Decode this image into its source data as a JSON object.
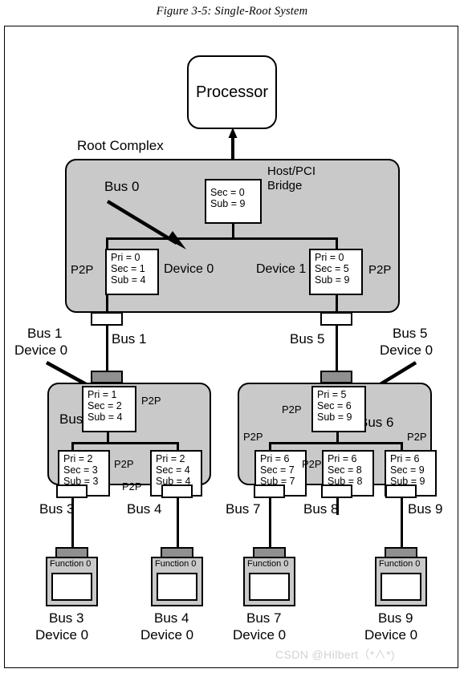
{
  "caption": "Figure 3-5: Single-Root System",
  "watermark": "CSDN @Hilbert（*∧*)",
  "processor": {
    "label": "Processor"
  },
  "root_complex": {
    "title": "Root Complex",
    "bus_label": "Bus 0",
    "bridge_title_line1": "Host/PCI",
    "bridge_title_line2": "Bridge",
    "bridge_regs": {
      "sec": "Sec = 0",
      "sub": "Sub = 9"
    },
    "device0_label": "Device 0",
    "device1_label": "Device 1",
    "p2p_left_label": "P2P",
    "p2p_right_label": "P2P",
    "port0_regs": {
      "pri": "Pri = 0",
      "sec": "Sec = 1",
      "sub": "Sub = 4"
    },
    "port1_regs": {
      "pri": "Pri = 0",
      "sec": "Sec = 5",
      "sub": "Sub = 9"
    }
  },
  "links": {
    "bus1_left_callout_line1": "Bus 1",
    "bus1_left_callout_line2": "Device 0",
    "bus1_label": "Bus 1",
    "bus5_label": "Bus 5",
    "bus5_right_callout_line1": "Bus 5",
    "bus5_right_callout_line2": "Device 0"
  },
  "switch_left": {
    "bus_label": "Bus 2",
    "upstream": {
      "p2p_label": "P2P",
      "regs": {
        "pri": "Pri = 1",
        "sec": "Sec = 2",
        "sub": "Sub = 4"
      }
    },
    "downstream": [
      {
        "p2p_label": "P2P",
        "regs": {
          "pri": "Pri = 2",
          "sec": "Sec = 3",
          "sub": "Sub = 3"
        },
        "bus_label": "Bus 3"
      },
      {
        "p2p_label": "P2P",
        "regs": {
          "pri": "Pri = 2",
          "sec": "Sec = 4",
          "sub": "Sub = 4"
        },
        "bus_label": "Bus 4"
      }
    ]
  },
  "switch_right": {
    "bus_label": "Bus 6",
    "upstream": {
      "p2p_label": "P2P",
      "regs": {
        "pri": "Pri = 5",
        "sec": "Sec = 6",
        "sub": "Sub = 9"
      }
    },
    "downstream": [
      {
        "p2p_label": "P2P",
        "regs": {
          "pri": "Pri = 6",
          "sec": "Sec = 7",
          "sub": "Sub = 7"
        },
        "bus_label": "Bus 7"
      },
      {
        "p2p_label": "P2P",
        "regs": {
          "pri": "Pri = 6",
          "sec": "Sec = 8",
          "sub": "Sub = 8"
        },
        "bus_label": "Bus 8"
      },
      {
        "p2p_label": "P2P",
        "regs": {
          "pri": "Pri = 6",
          "sec": "Sec = 9",
          "sub": "Sub = 9"
        },
        "bus_label": "Bus 9"
      }
    ]
  },
  "endpoints": [
    {
      "function_label": "Function 0",
      "caption_line1": "Bus 3",
      "caption_line2": "Device 0"
    },
    {
      "function_label": "Function 0",
      "caption_line1": "Bus 4",
      "caption_line2": "Device 0"
    },
    {
      "function_label": "Function 0",
      "caption_line1": "Bus 7",
      "caption_line2": "Device 0"
    },
    {
      "function_label": "Function 0",
      "caption_line1": "Bus 9",
      "caption_line2": "Device 0"
    }
  ],
  "colors": {
    "complex_fill": "#c9c9c9",
    "port_stub_fill": "#8f8f8f",
    "register_fill": "#ffffff",
    "outline": "#000000",
    "watermark": "#d2d2d2"
  }
}
